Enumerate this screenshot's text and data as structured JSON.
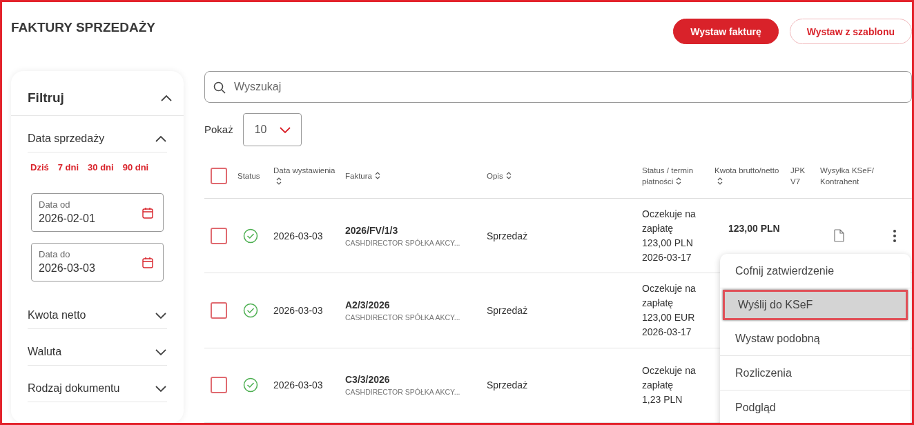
{
  "page": {
    "title": "FAKTURY SPRZEDAŻY"
  },
  "actions": [
    {
      "label": "Wystaw fakturę",
      "kind": "primary"
    },
    {
      "label": "Wystaw z szablonu",
      "kind": "secondary"
    }
  ],
  "filters": {
    "title": "Filtruj",
    "expanded": true,
    "sections": [
      {
        "label": "Data sprzedaży",
        "expanded": true,
        "quick_ranges": [
          "Dziś",
          "7 dni",
          "30 dni",
          "90 dni"
        ],
        "fields": [
          {
            "label": "Data od",
            "value": "2026-02-01"
          },
          {
            "label": "Data do",
            "value": "2026-03-03"
          }
        ]
      },
      {
        "label": "Kwota netto",
        "expanded": false
      },
      {
        "label": "Waluta",
        "expanded": false
      },
      {
        "label": "Rodzaj dokumentu",
        "expanded": false
      }
    ]
  },
  "search": {
    "placeholder": "Wyszukaj"
  },
  "page_size": {
    "label": "Pokaż",
    "value": "10"
  },
  "table": {
    "select_all": {
      "checked": false
    },
    "columns": [
      {
        "label": "Status",
        "sortable": false
      },
      {
        "label": "Data wystawienia",
        "sortable": true
      },
      {
        "label": "Faktura",
        "sortable": true
      },
      {
        "label": "Opis",
        "sortable": true
      },
      {
        "label": "Status / termin płatności",
        "sortable": true
      },
      {
        "label": "Kwota brutto/netto",
        "sortable": true
      },
      {
        "label": "JPK V7",
        "sortable": false
      },
      {
        "label": "Wysyłka KSeF/ Kontrahent",
        "sortable": false
      }
    ],
    "rows": [
      {
        "checked": false,
        "approved": true,
        "date": "2026-03-03",
        "invoice": "2026/FV/1/3",
        "contractor": "CASHDIRECTOR SPÓŁKA AKCY...",
        "description": "Sprzedaż",
        "payment": [
          "Oczekuje na zapłatę",
          "123,00 PLN",
          "2026-03-17"
        ],
        "amount": "123,00 PLN",
        "actions_visible": true
      },
      {
        "checked": false,
        "approved": true,
        "date": "2026-03-03",
        "invoice": "A2/3/2026",
        "contractor": "CASHDIRECTOR SPÓŁKA AKCY...",
        "description": "Sprzedaż",
        "payment": [
          "Oczekuje na zapłatę",
          "123,00 EUR",
          "2026-03-17"
        ],
        "actions_visible": false
      },
      {
        "checked": false,
        "approved": true,
        "date": "2026-03-03",
        "invoice": "C3/3/2026",
        "contractor": "CASHDIRECTOR SPÓŁKA AKCY...",
        "description": "Sprzedaż",
        "payment": [
          "Oczekuje na zapłatę",
          "1,23 PLN"
        ],
        "actions_visible": false
      }
    ]
  },
  "context_menu": {
    "items": [
      {
        "label": "Cofnij zatwierdzenie",
        "highlighted": false
      },
      {
        "label": "Wyślij do KSeF",
        "highlighted": true
      },
      {
        "label": "Wystaw podobną",
        "highlighted": false
      },
      {
        "label": "Rozliczenia",
        "highlighted": false
      },
      {
        "label": "Podgląd",
        "highlighted": false
      }
    ]
  }
}
